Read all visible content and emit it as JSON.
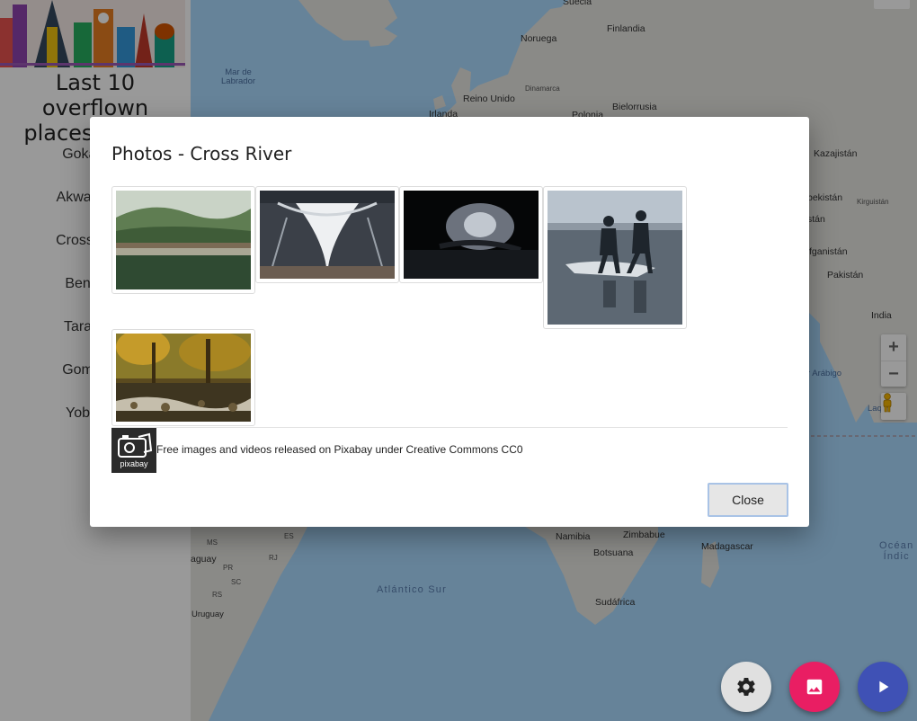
{
  "sidebar": {
    "title_line1": "Last 10 overflown",
    "title_line2": "places by ISS",
    "places": [
      "Gokar",
      "Akwa Ib",
      "Cross R",
      "Benu",
      "Tarab",
      "Gomb",
      "Yobe"
    ]
  },
  "map": {
    "labels": {
      "suecia": "Suecia",
      "noruega": "Noruega",
      "finlandia": "Finlandia",
      "mar_de": "Mar de",
      "labrador": "Labrador",
      "dinamarca": "Dinamarca",
      "reino_unido": "Reino Unido",
      "bielorrusia": "Bielorrusia",
      "irlanda": "Irlanda",
      "polonia": "Polonia",
      "kazajistan": "Kazajistán",
      "uzbekistan": "bekistán",
      "kirguistan": "Kirguistán",
      "tayikistan": "stán",
      "afganistan": "fganistán",
      "pakistan": "Pakistán",
      "india": "India",
      "mar_arabigo": "r Arábigo",
      "laq": "Laq",
      "m": "M",
      "ms": "MS",
      "es": "ES",
      "paraguay": "aguay",
      "pr": "PR",
      "rj": "RJ",
      "sc": "SC",
      "rs": "RS",
      "uruguay": "Uruguay",
      "namibia": "Namibia",
      "zimbabue": "Zimbabue",
      "botsuana": "Botsuana",
      "madagascar": "Madagascar",
      "sudafrica": "Sudáfrica",
      "atlantico_sur": "Atlántico Sur",
      "oceano": "Océan",
      "indico": "Índic"
    },
    "zoom_in": "+",
    "zoom_out": "−"
  },
  "dialog": {
    "title": "Photos - Cross River",
    "photos": [
      {
        "subject": "stone-bridge-over-river"
      },
      {
        "subject": "steel-bridge-underside"
      },
      {
        "subject": "dark-river-scene"
      },
      {
        "subject": "children-walking-in-water"
      },
      {
        "subject": "autumn-forest-stream"
      }
    ],
    "pixabay_logo_text": "pixabay",
    "credit_text": "Free images and videos released on Pixabay under Creative Commons CC0",
    "close_label": "Close"
  },
  "fabs": {
    "settings_icon": "gear-icon",
    "photos_icon": "image-icon",
    "play_icon": "play-icon",
    "colors": {
      "settings": "#e0e0e0",
      "photos": "#e91e63",
      "play": "#3f51b5"
    }
  }
}
